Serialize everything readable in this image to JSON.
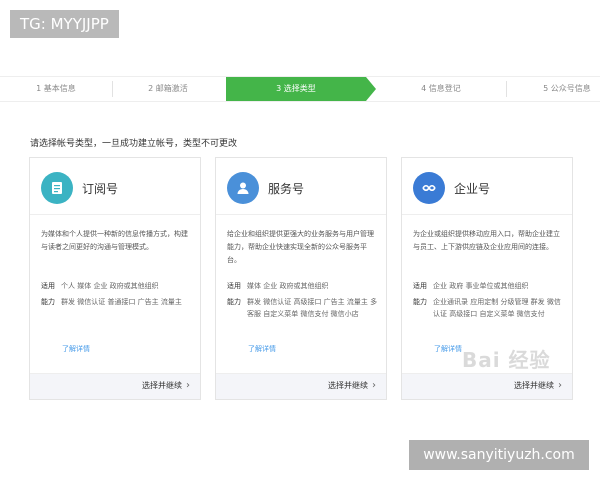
{
  "watermarks": {
    "tag": "TG: MYYJJPP",
    "url": "www.sanyitiyuzh.com",
    "baidu": "Bai 经验"
  },
  "steps": [
    {
      "label": "1 基本信息",
      "active": false
    },
    {
      "label": "2 邮箱激活",
      "active": false
    },
    {
      "label": "3 选择类型",
      "active": true
    },
    {
      "label": "4 信息登记",
      "active": false
    },
    {
      "label": "5 公众号信息",
      "active": false
    }
  ],
  "colors": {
    "accent": "#44b549",
    "link": "#459ae9"
  },
  "instruction": "请选择帐号类型，一旦成功建立帐号，类型不可更改",
  "cards": [
    {
      "title": "订阅号",
      "icon": "subscription-icon",
      "icon_color": "#3bb3c3",
      "desc": "为媒体和个人提供一种新的信息传播方式，构建与读者之间更好的沟通与管理模式。",
      "apply_label": "适用",
      "apply": "个人 媒体 企业 政府或其他组织",
      "ability_label": "能力",
      "ability": "群发 微信认证 普通接口 广告主 流量主",
      "more": "了解详情",
      "choose": "选择并继续"
    },
    {
      "title": "服务号",
      "icon": "service-icon",
      "icon_color": "#4a90d9",
      "desc": "给企业和组织提供更强大的业务服务与用户管理能力，帮助企业快速实现全新的公众号服务平台。",
      "apply_label": "适用",
      "apply": "媒体 企业 政府或其他组织",
      "ability_label": "能力",
      "ability": "群发 微信认证 高级接口 广告主 流量主 多客服 自定义菜单 微信支付 微信小店",
      "more": "了解详情",
      "choose": "选择并继续"
    },
    {
      "title": "企业号",
      "icon": "enterprise-icon",
      "icon_color": "#3a7bd5",
      "desc": "为企业或组织提供移动应用入口，帮助企业建立与员工、上下游供应链及企业应用间的连接。",
      "apply_label": "适用",
      "apply": "企业 政府 事业单位或其他组织",
      "ability_label": "能力",
      "ability": "企业通讯录 应用定制 分级管理 群发 微信认证 高级接口 自定义菜单 微信支付",
      "more": "了解详情",
      "choose": "选择并继续"
    }
  ]
}
